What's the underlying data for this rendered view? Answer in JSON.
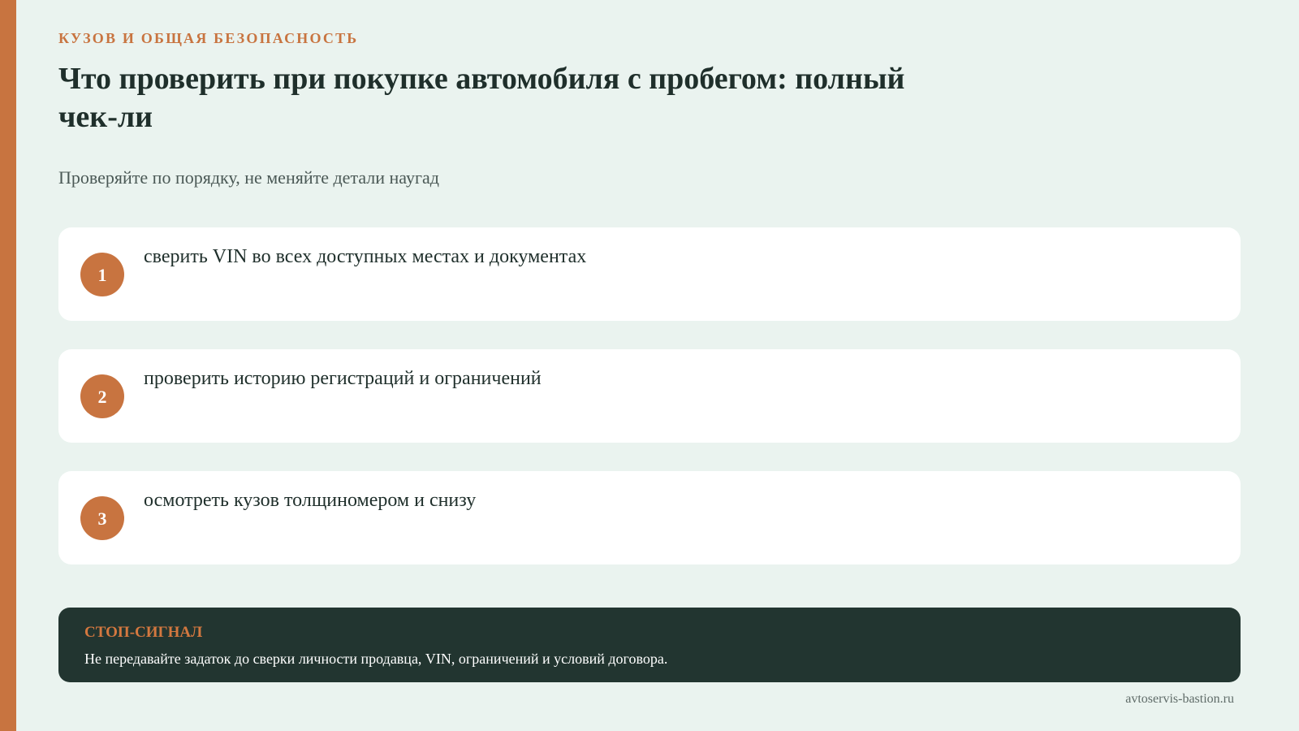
{
  "header": {
    "eyebrow": "КУЗОВ И ОБЩАЯ БЕЗОПАСНОСТЬ",
    "title": "Что проверить при покупке автомобиля с пробегом: полный чек-ли",
    "subtitle": "Проверяйте по порядку, не меняйте детали наугад"
  },
  "steps": [
    {
      "number": "1",
      "text": "сверить VIN во всех доступных местах и документах"
    },
    {
      "number": "2",
      "text": "проверить историю регистраций и ограничений"
    },
    {
      "number": "3",
      "text": "осмотреть кузов толщиномером и снизу"
    }
  ],
  "warning": {
    "title": "СТОП-СИГНАЛ",
    "text": "Не передавайте задаток до сверки личности продавца, VIN, ограничений и условий договора."
  },
  "footer": {
    "site": "avtoservis-bastion.ru"
  },
  "colors": {
    "accent": "#c87440",
    "background": "#eaf3ef",
    "dark_panel": "#223530"
  }
}
